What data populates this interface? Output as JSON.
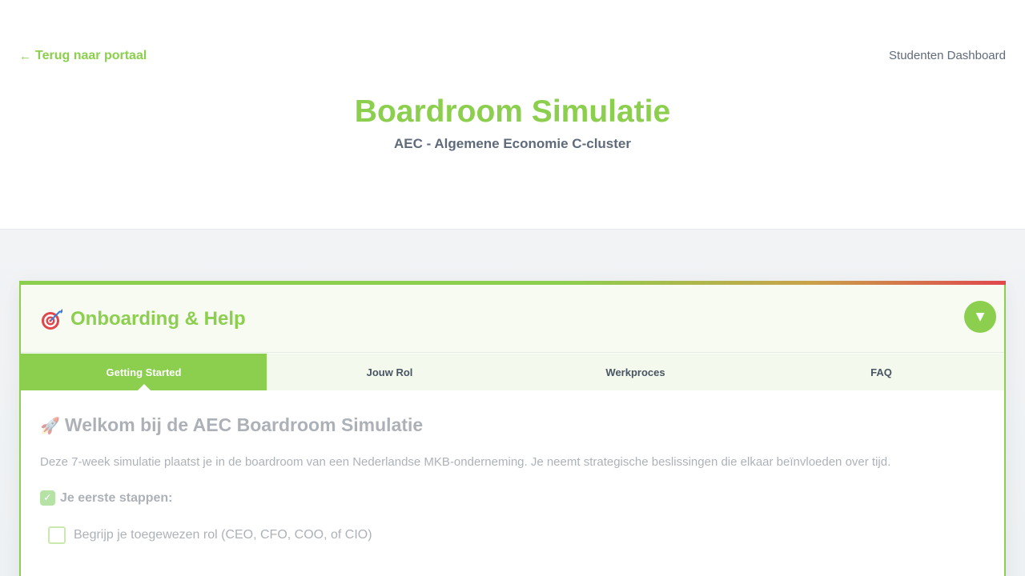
{
  "header": {
    "back_link": "Terug naar portaal",
    "dashboard_link": "Studenten Dashboard",
    "title": "Boardroom Simulatie",
    "subtitle": "AEC - Algemene Economie C-cluster"
  },
  "card": {
    "title": "Onboarding & Help",
    "title_icon": "dart-icon",
    "toggle_icon": "▼",
    "tabs": [
      {
        "label": "Getting Started",
        "active": true
      },
      {
        "label": "Jouw Rol",
        "active": false
      },
      {
        "label": "Werkproces",
        "active": false
      },
      {
        "label": "FAQ",
        "active": false
      }
    ]
  },
  "content": {
    "title": "Welkom bij de AEC Boardroom Simulatie",
    "title_icon": "rocket-icon",
    "intro": "Deze 7-week simulatie plaatst je in de boardroom van een Nederlandse MKB-onderneming. Je neemt strategische beslissingen die elkaar beïnvloeden over tijd.",
    "steps_heading": "Je eerste stappen:",
    "steps": [
      "Begrijp je toegewezen rol (CEO, CFO, COO, of CIO)"
    ]
  },
  "colors": {
    "accent": "#8ccf4e",
    "text_muted": "#5f6b7a"
  }
}
